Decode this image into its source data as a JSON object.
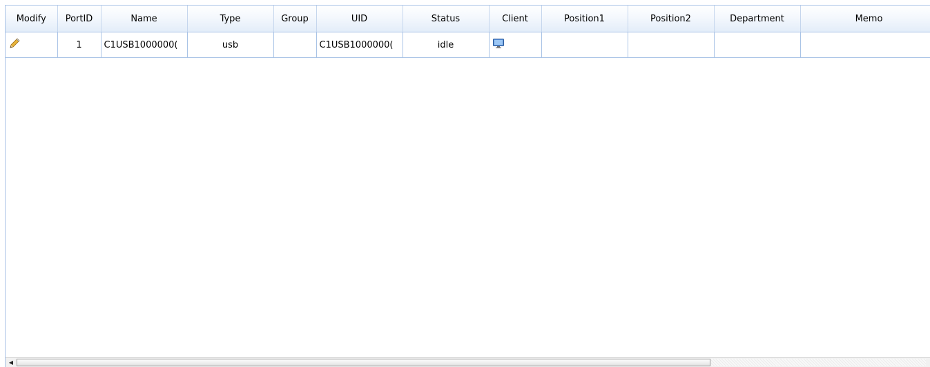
{
  "columns": [
    {
      "key": "modify",
      "label": "Modify"
    },
    {
      "key": "portid",
      "label": "PortID"
    },
    {
      "key": "name",
      "label": "Name"
    },
    {
      "key": "type",
      "label": "Type"
    },
    {
      "key": "group",
      "label": "Group"
    },
    {
      "key": "uid",
      "label": "UID"
    },
    {
      "key": "status",
      "label": "Status"
    },
    {
      "key": "client",
      "label": "Client"
    },
    {
      "key": "position1",
      "label": "Position1"
    },
    {
      "key": "position2",
      "label": "Position2"
    },
    {
      "key": "department",
      "label": "Department"
    },
    {
      "key": "memo",
      "label": "Memo"
    }
  ],
  "rows": [
    {
      "modify_icon": "pencil-icon",
      "portid": "1",
      "name": "C1USB1000000(",
      "type": "usb",
      "group": "",
      "uid": "C1USB1000000(",
      "status": "idle",
      "client_icon": "monitor-icon",
      "position1": "",
      "position2": "",
      "department": "",
      "memo": ""
    }
  ],
  "scrollbar": {
    "left_arrow": "◀"
  },
  "colors": {
    "border": "#a9c3e6",
    "header_bg": "#e3edf9"
  }
}
